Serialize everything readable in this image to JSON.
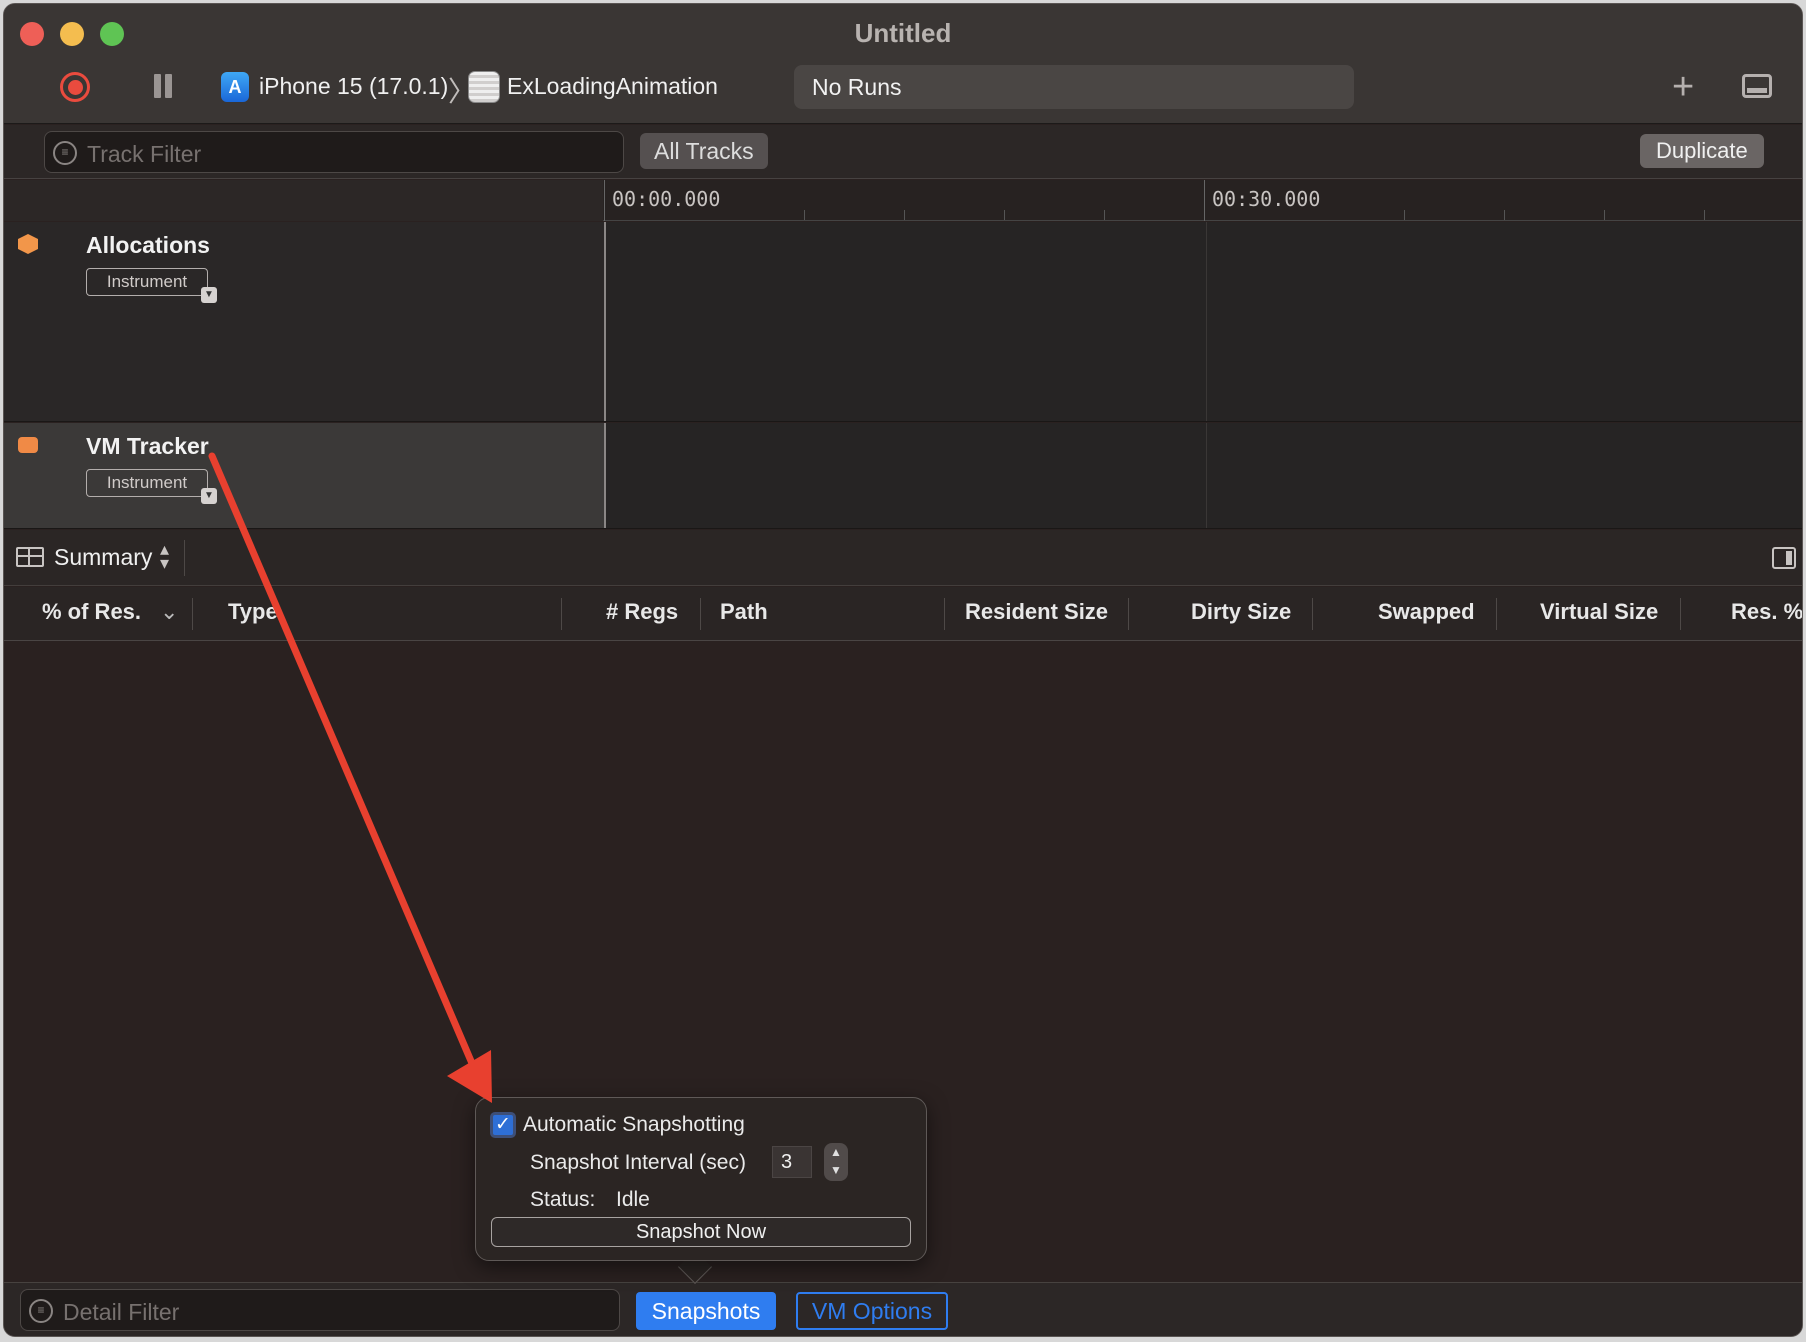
{
  "window": {
    "title": "Untitled"
  },
  "toolbar": {
    "device": "iPhone 15 (17.0.1)",
    "project": "ExLoadingAnimation",
    "runs_label": "No Runs"
  },
  "filterbar": {
    "track_filter_placeholder": "Track Filter",
    "all_tracks_label": "All Tracks",
    "duplicate_label": "Duplicate"
  },
  "timeline": {
    "ticks": [
      "00:00.000",
      "00:30.000"
    ]
  },
  "tracks": [
    {
      "name": "Allocations",
      "badge": "Instrument",
      "icon": "cube-icon",
      "color": "#f2964a"
    },
    {
      "name": "VM Tracker",
      "badge": "Instrument",
      "icon": "memory-icon",
      "color": "#f08a46"
    }
  ],
  "detail": {
    "view_label": "Summary",
    "columns": [
      "% of Res.",
      "Type",
      "# Regs",
      "Path",
      "Resident Size",
      "Dirty Size",
      "Swapped",
      "Virtual Size",
      "Res. %"
    ]
  },
  "popover": {
    "auto_label": "Automatic Snapshotting",
    "auto_checked": true,
    "interval_label": "Snapshot Interval (sec)",
    "interval_value": "3",
    "status_label": "Status:",
    "status_value": "Idle",
    "snapshot_now_label": "Snapshot Now"
  },
  "bottombar": {
    "detail_filter_placeholder": "Detail Filter",
    "snapshots_label": "Snapshots",
    "vm_options_label": "VM Options"
  },
  "colors": {
    "accent": "#2f7df0",
    "record": "#ea4b3e",
    "annotation_arrow": "#e8402f"
  }
}
